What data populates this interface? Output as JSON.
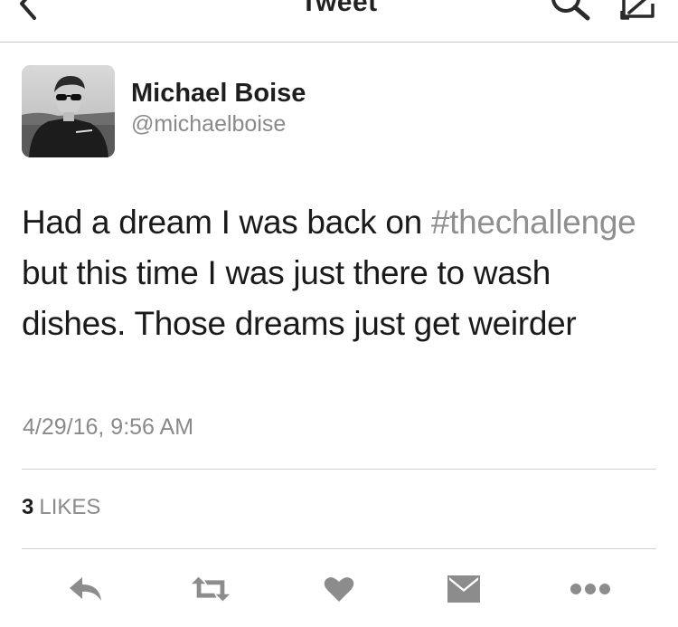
{
  "nav": {
    "title": "Tweet"
  },
  "author": {
    "name": "Michael Boise",
    "handle": "@michaelboise"
  },
  "tweet": {
    "text_before": "Had a dream I was back on ",
    "hashtag": "#thechallenge",
    "text_after": " but this time I was just there to wash dishes. Those dreams just get weirder",
    "timestamp": "4/29/16, 9:56 AM"
  },
  "stats": {
    "likes_count": "3",
    "likes_label": "LIKES"
  },
  "actions": [
    {
      "icon": "reply-icon"
    },
    {
      "icon": "retweet-icon"
    },
    {
      "icon": "heart-icon"
    },
    {
      "icon": "direct-message-icon"
    },
    {
      "icon": "more-icon"
    }
  ],
  "colors": {
    "text": "#1a1a1a",
    "secondary": "#8a8a8a",
    "icon": "#8c8c8c"
  }
}
